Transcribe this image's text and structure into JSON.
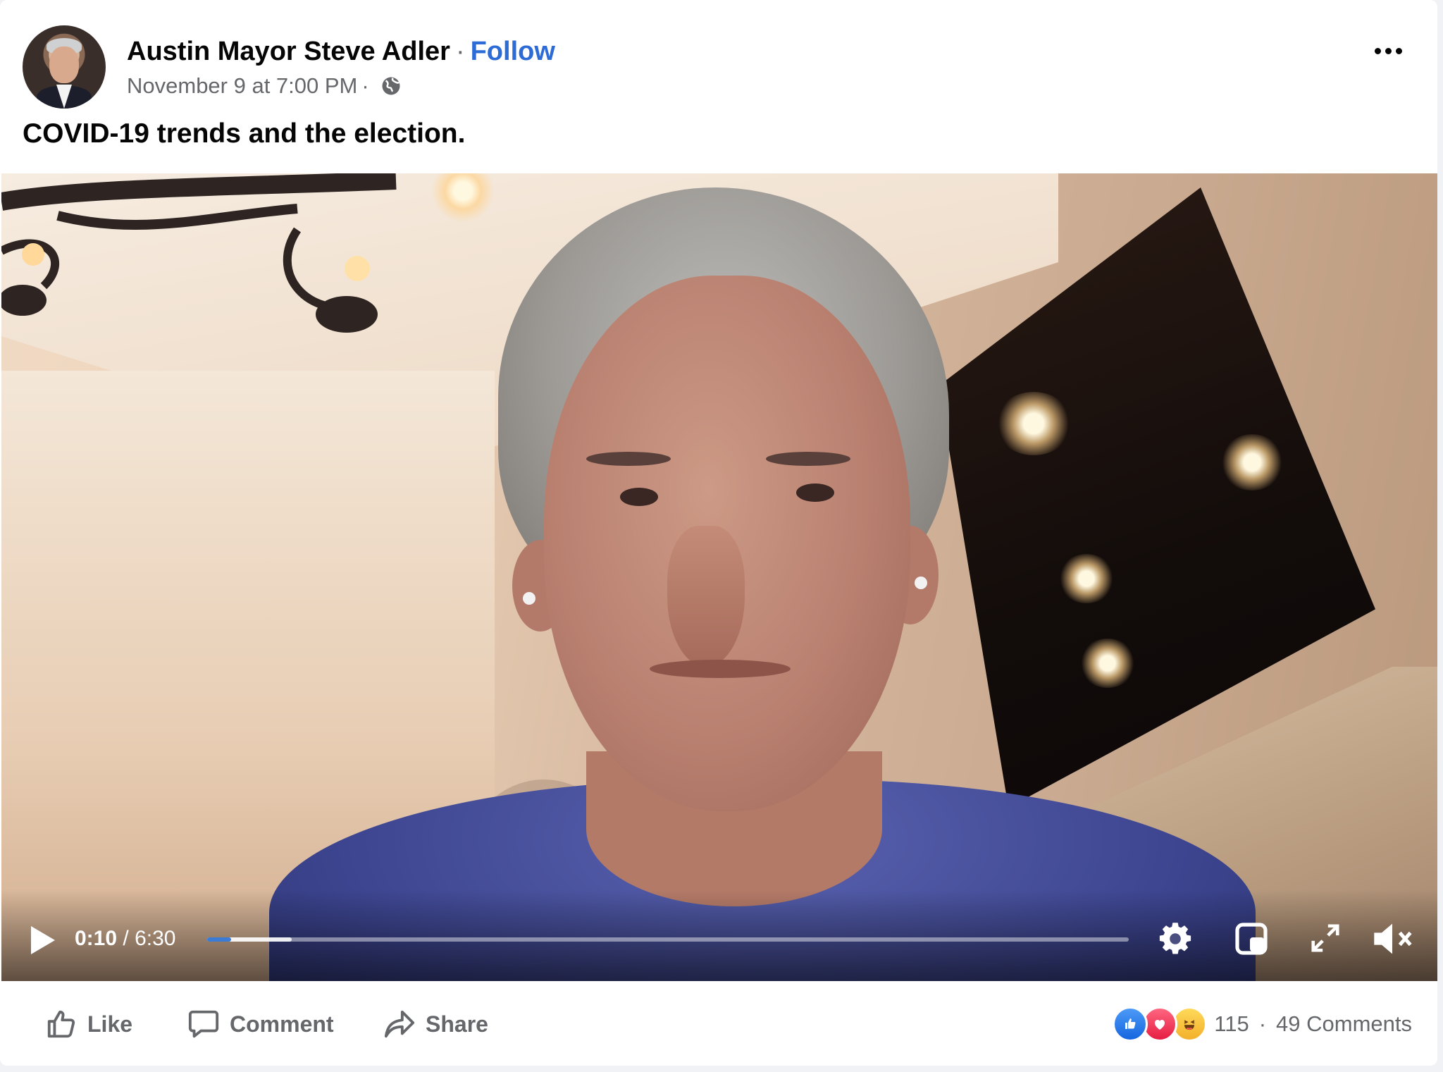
{
  "post": {
    "author": "Austin Mayor Steve Adler",
    "separator": "·",
    "follow_label": "Follow",
    "timestamp": "November 9 at 7:00 PM",
    "meta_separator": "·",
    "privacy_icon": "globe-icon",
    "text": "COVID-19 trends and the election."
  },
  "video": {
    "current_time": "0:10",
    "time_separator": "/",
    "duration": "6:30",
    "progress_fraction": 0.026,
    "buffered_fraction": 0.092,
    "icons": [
      "play-icon",
      "settings-gear-icon",
      "picture-in-picture-icon",
      "fullscreen-icon",
      "muted-volume-icon"
    ]
  },
  "footer": {
    "like_label": "Like",
    "comment_label": "Comment",
    "share_label": "Share",
    "reactions": [
      "like",
      "love",
      "haha"
    ],
    "reaction_count": "115",
    "separator": "·",
    "comments_count": "49 Comments"
  },
  "colors": {
    "follow": "#2d6bd6",
    "progress": "#3a7bd5",
    "secondary_text": "#65676b"
  }
}
